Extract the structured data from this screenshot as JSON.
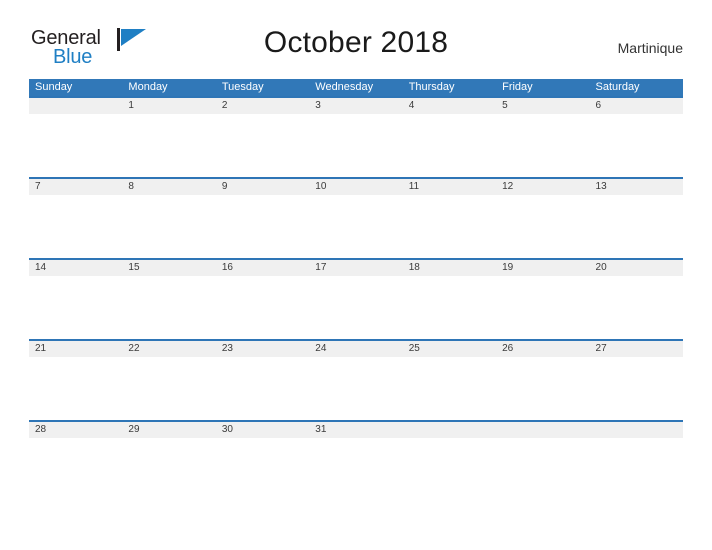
{
  "logo": {
    "word_one": "General",
    "word_two": "Blue",
    "mark": "flag-triangle-icon"
  },
  "header": {
    "title": "October 2018",
    "region": "Martinique"
  },
  "colors": {
    "header_blue": "#3178b8",
    "row_rule_blue": "#2e75b6",
    "band_gray": "#f0f0f0",
    "logo_blue": "#1f7fc4",
    "page_background": "#ffffff"
  },
  "calendar": {
    "weekdays": [
      "Sunday",
      "Monday",
      "Tuesday",
      "Wednesday",
      "Thursday",
      "Friday",
      "Saturday"
    ],
    "weeks": [
      [
        "",
        "1",
        "2",
        "3",
        "4",
        "5",
        "6"
      ],
      [
        "7",
        "8",
        "9",
        "10",
        "11",
        "12",
        "13"
      ],
      [
        "14",
        "15",
        "16",
        "17",
        "18",
        "19",
        "20"
      ],
      [
        "21",
        "22",
        "23",
        "24",
        "25",
        "26",
        "27"
      ],
      [
        "28",
        "29",
        "30",
        "31",
        "",
        "",
        ""
      ]
    ]
  }
}
